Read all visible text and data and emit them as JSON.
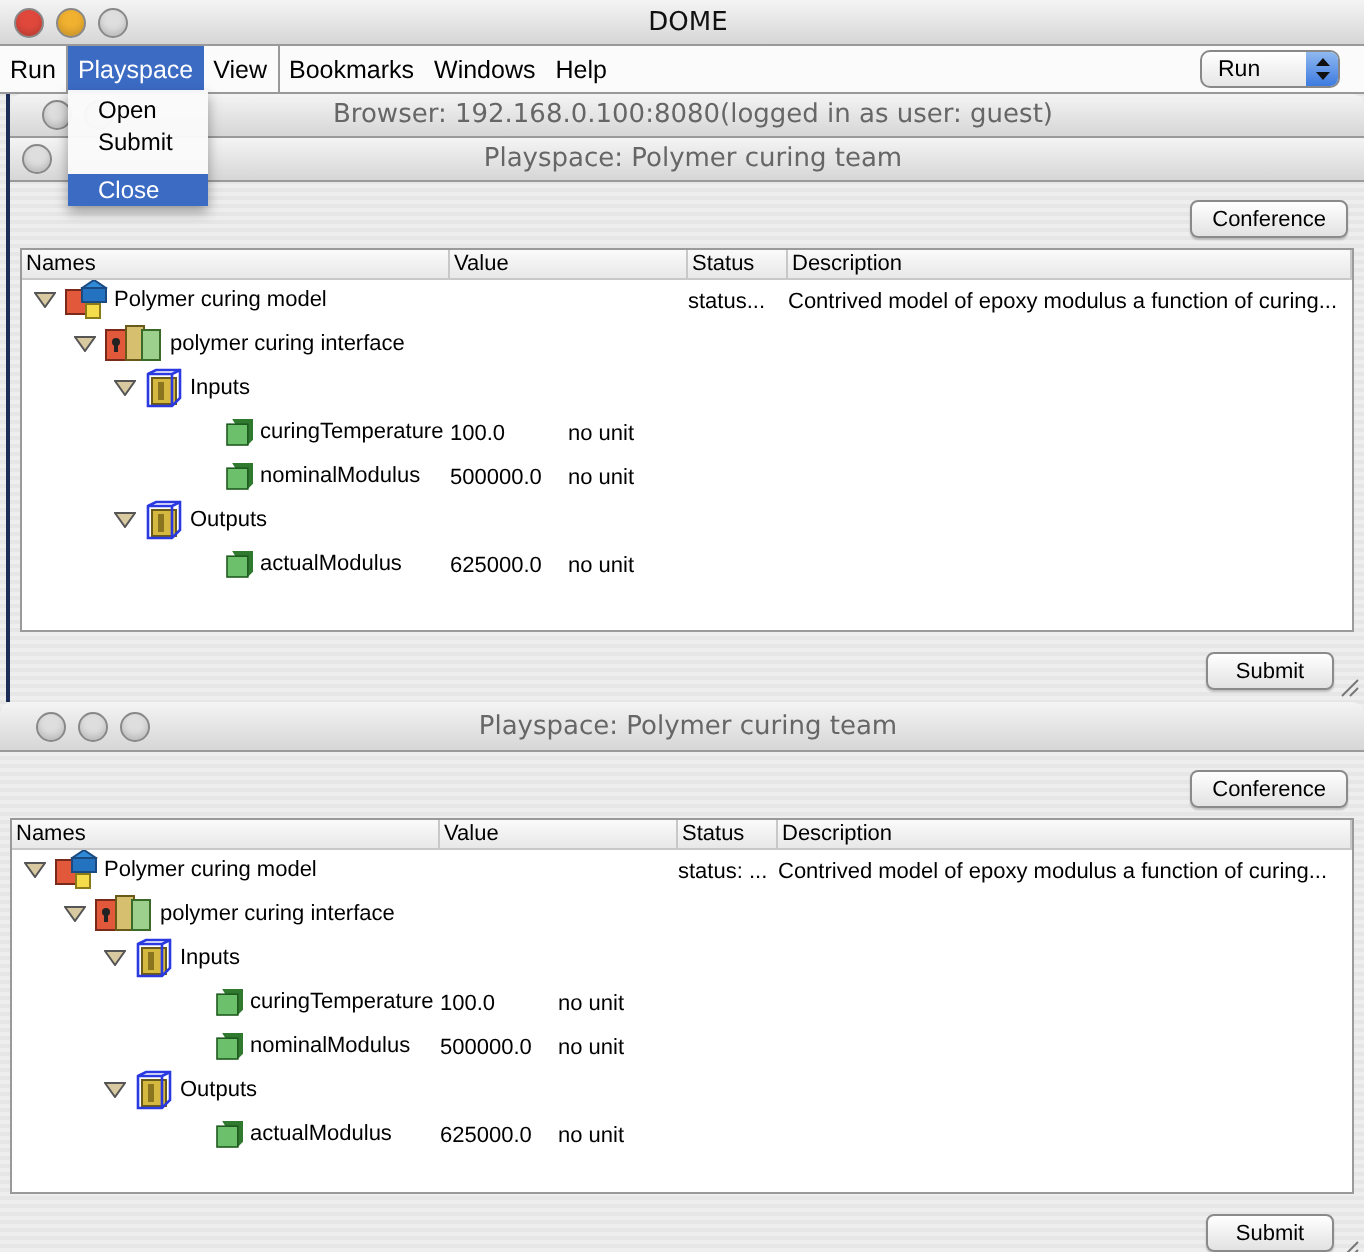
{
  "window": {
    "title": "DOME"
  },
  "menu_bar": {
    "items": [
      {
        "label": "Run",
        "selected": false
      },
      {
        "label": "Playspace",
        "selected": true
      },
      {
        "label": "View",
        "selected": false
      },
      {
        "label": "Bookmarks",
        "selected": false
      },
      {
        "label": "Windows",
        "selected": false
      },
      {
        "label": "Help",
        "selected": false
      }
    ],
    "mode_select": {
      "value": "Run"
    }
  },
  "open_menu": {
    "items": [
      {
        "kind": "item",
        "label": "Open",
        "selected": false
      },
      {
        "kind": "item",
        "label": "Submit",
        "selected": false
      },
      {
        "kind": "separator"
      },
      {
        "kind": "item",
        "label": "Close",
        "selected": true
      }
    ]
  },
  "browser_window": {
    "title": "Browser: 192.168.0.100:8080(logged in as user: guest)"
  },
  "playspaces": [
    {
      "title": "Playspace: Polymer curing team",
      "conference_button": "Conference",
      "submit_button": "Submit",
      "columns": [
        "Names",
        "Value",
        "Status",
        "Description"
      ],
      "rows": [
        {
          "kind": "model",
          "name": "Polymer curing model",
          "expanded": true,
          "status": "status...",
          "description": "Contrived model  of epoxy modulus a function of curing...",
          "children": [
            {
              "kind": "interface",
              "name": "polymer curing interface",
              "expanded": true,
              "children": [
                {
                  "kind": "group",
                  "name": "Inputs",
                  "expanded": true,
                  "children": [
                    {
                      "kind": "parameter",
                      "name": "curingTemperature",
                      "value": "100.0",
                      "unit": "no unit"
                    },
                    {
                      "kind": "parameter",
                      "name": "nominalModulus",
                      "value": "500000.0",
                      "unit": "no unit"
                    }
                  ]
                },
                {
                  "kind": "group",
                  "name": "Outputs",
                  "expanded": true,
                  "children": [
                    {
                      "kind": "parameter",
                      "name": "actualModulus",
                      "value": "625000.0",
                      "unit": "no unit"
                    }
                  ]
                }
              ]
            }
          ]
        }
      ]
    },
    {
      "title": "Playspace: Polymer curing team",
      "conference_button": "Conference",
      "submit_button": "Submit",
      "columns": [
        "Names",
        "Value",
        "Status",
        "Description"
      ],
      "rows": [
        {
          "kind": "model",
          "name": "Polymer curing model",
          "expanded": true,
          "status": "status: ...",
          "description": "Contrived model  of epoxy modulus a function of curing...",
          "children": [
            {
              "kind": "interface",
              "name": "polymer curing interface",
              "expanded": true,
              "children": [
                {
                  "kind": "group",
                  "name": "Inputs",
                  "expanded": true,
                  "children": [
                    {
                      "kind": "parameter",
                      "name": "curingTemperature",
                      "value": "100.0",
                      "unit": "no unit"
                    },
                    {
                      "kind": "parameter",
                      "name": "nominalModulus",
                      "value": "500000.0",
                      "unit": "no unit"
                    }
                  ]
                },
                {
                  "kind": "group",
                  "name": "Outputs",
                  "expanded": true,
                  "children": [
                    {
                      "kind": "parameter",
                      "name": "actualModulus",
                      "value": "625000.0",
                      "unit": "no unit"
                    }
                  ]
                }
              ]
            }
          ]
        }
      ]
    }
  ]
}
